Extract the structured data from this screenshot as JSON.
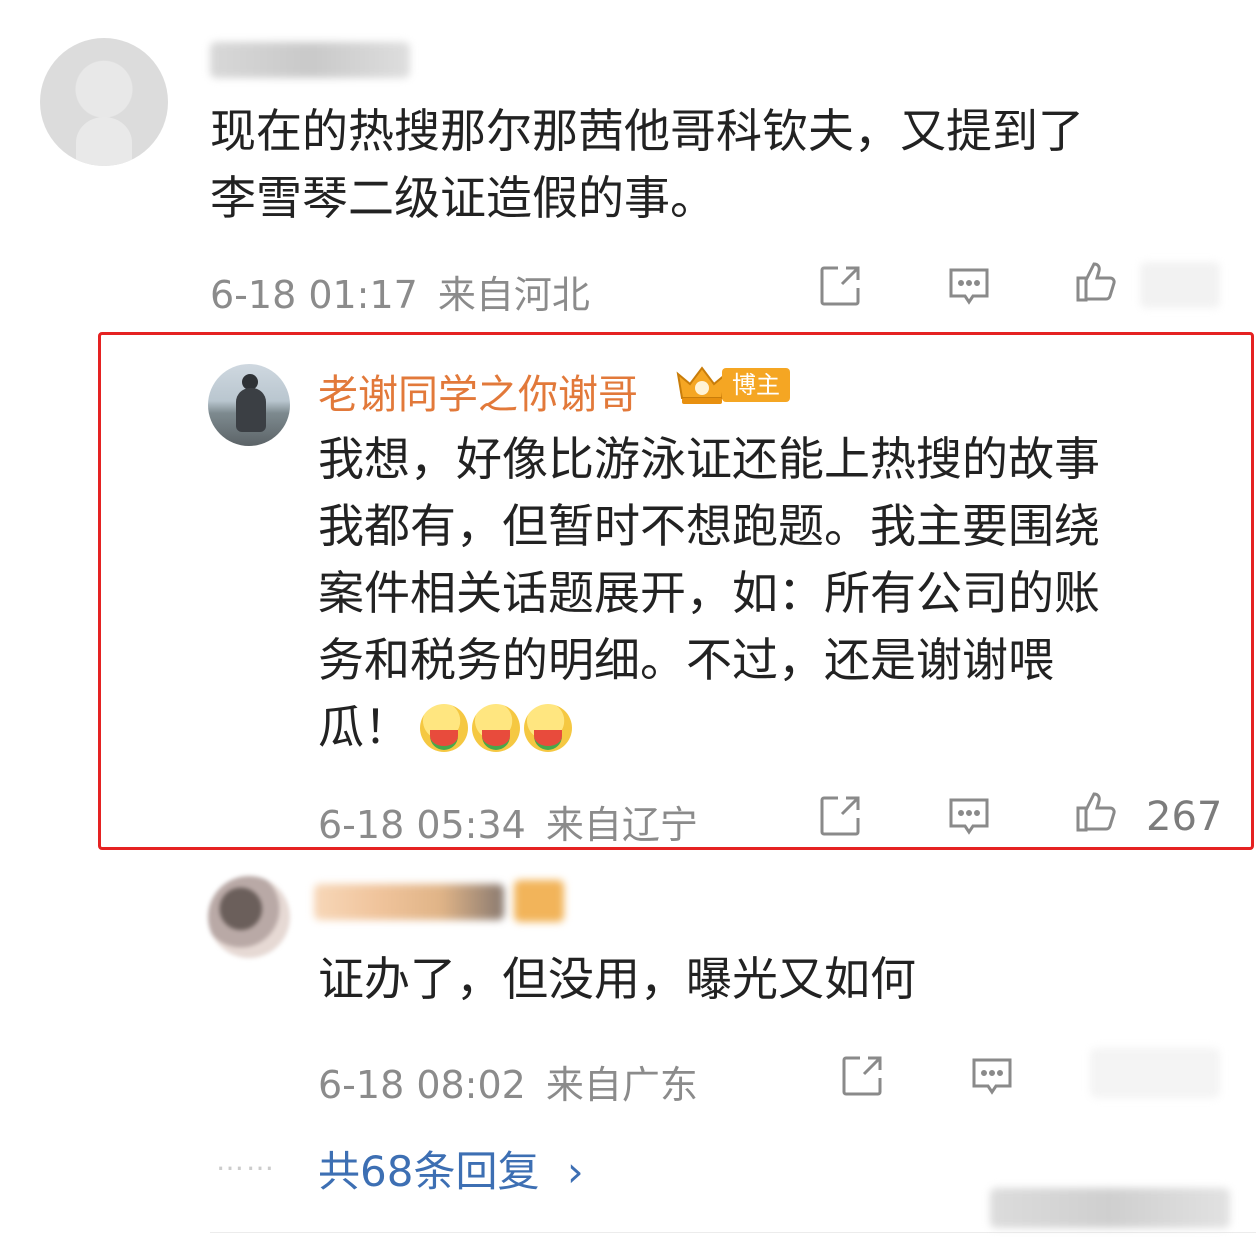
{
  "comments": [
    {
      "username": "",
      "text_lines": [
        "现在的热搜那尔那茜他哥科钦夫，又提到了",
        "李雪琴二级证造假的事。"
      ],
      "date": "6-18 01:17",
      "region": "来自河北",
      "like_count": ""
    },
    {
      "username": "老谢同学之你谢哥",
      "badge": "博主",
      "text_lines": [
        "我想，好像比游泳证还能上热搜的故事",
        "我都有，但暂时不想跑题。我主要围绕",
        "案件相关话题展开，如：所有公司的账",
        "务和税务的明细。不过，还是谢谢喂",
        "瓜！"
      ],
      "emojis": [
        "watermelon-emoji",
        "watermelon-emoji",
        "watermelon-emoji"
      ],
      "date": "6-18 05:34",
      "region": "来自辽宁",
      "like_count": "267"
    },
    {
      "username": "",
      "text_lines": [
        "证办了，但没用，曝光又如何"
      ],
      "date": "6-18 08:02",
      "region": "来自广东",
      "like_count": ""
    }
  ],
  "replies": {
    "dots": "……",
    "label": "共68条回复",
    "arrow": "›"
  },
  "colors": {
    "username": "#e2793a",
    "highlight_border": "#e52222",
    "reply_link": "#3d6fb3",
    "meta": "#8b8b8b"
  },
  "icons": [
    "share-icon",
    "comment-icon",
    "like-icon"
  ]
}
